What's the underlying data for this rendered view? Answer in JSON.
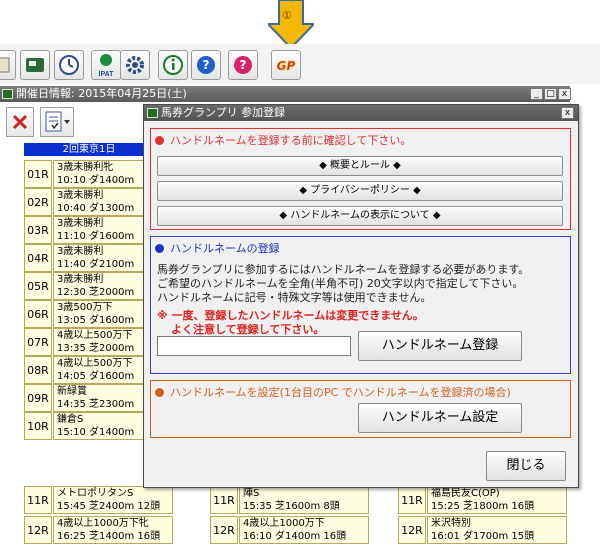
{
  "annotation": {
    "marker": "①",
    "arrow_color": "#f5b800"
  },
  "toolbar": {
    "buttons": [
      {
        "name": "partial-left-icon"
      },
      {
        "name": "card-icon"
      },
      {
        "name": "clock-icon"
      },
      {
        "name": "ipat-icon",
        "label": "IPAT"
      },
      {
        "name": "gear-icon"
      },
      {
        "name": "info-icon"
      },
      {
        "name": "help-icon"
      },
      {
        "name": "question-red-icon"
      },
      {
        "name": "gp-icon",
        "label": "GP"
      }
    ]
  },
  "main_window": {
    "title": "開催日情報: 2015年04月25日(土)",
    "min_label": "_",
    "max_label": "□",
    "close_label": "x"
  },
  "venue_header": "2回東京1日",
  "races_col1": [
    {
      "num": "01R",
      "name": "3歳未勝利牝",
      "info": "10:10 ダ1400m"
    },
    {
      "num": "02R",
      "name": "3歳未勝利",
      "info": "10:40 ダ1300m"
    },
    {
      "num": "03R",
      "name": "3歳未勝利",
      "info": "11:10 ダ1600m"
    },
    {
      "num": "04R",
      "name": "3歳未勝利",
      "info": "11:40 ダ2100m"
    },
    {
      "num": "05R",
      "name": "3歳未勝利",
      "info": "12:30 芝2000m"
    },
    {
      "num": "06R",
      "name": "3歳500万下",
      "info": "13:05 ダ1600m"
    },
    {
      "num": "07R",
      "name": "4歳以上500万下",
      "info": "13:35 芝2000m"
    },
    {
      "num": "08R",
      "name": "4歳以上500万下",
      "info": "14:05 ダ1600m"
    },
    {
      "num": "09R",
      "name": "新緑賞",
      "info": "14:35 芝2300m"
    },
    {
      "num": "10R",
      "name": "鎌倉S",
      "info": "15:10 ダ1400m"
    },
    {
      "num": "11R",
      "name": "メトロポリタンS",
      "info": "15:45 芝2400m 12頭"
    },
    {
      "num": "12R",
      "name": "4歳以上1000万下牝",
      "info": "16:25 芝1400m 16頭"
    }
  ],
  "races_col2": [
    {
      "num": "11R",
      "name": "陣S",
      "info": "15:35 芝1600m 8頭"
    },
    {
      "num": "12R",
      "name": "4歳以上1000万下",
      "info": "16:10 ダ1400m 16頭"
    }
  ],
  "races_col3": [
    {
      "num": "11R",
      "name": "福島民友C(OP)",
      "info": "15:25 芝1800m 16頭"
    },
    {
      "num": "12R",
      "name": "米沢特別",
      "info": "16:01 ダ1700m 15頭"
    }
  ],
  "dialog": {
    "title": "馬券グランプリ 参加登録",
    "close_label": "x",
    "section1": {
      "title": "ハンドルネームを登録する前に確認して下さい。",
      "buttons": [
        "◆ 概要とルール ◆",
        "◆ プライバシーポリシー ◆",
        "◆ ハンドルネームの表示について ◆"
      ]
    },
    "section2": {
      "title": "ハンドルネームの登録",
      "lines": [
        "馬券グランプリに参加するにはハンドルネームを登録する必要があります。",
        "ご希望のハンドルネームを全角(半角不可) 20文字以内で指定して下さい。",
        "ハンドルネームに記号・特殊文字等は使用できません。"
      ],
      "warning1": "※ 一度、登録したハンドルネームは変更できません。",
      "warning2": "よく注意して登録して下さい。",
      "input_value": "",
      "register_button": "ハンドルネーム登録"
    },
    "section3": {
      "title": "ハンドルネームを設定(1台目のPC でハンドルネームを登録済の場合)",
      "set_button": "ハンドルネーム設定"
    },
    "close_button": "閉じる"
  },
  "colors": {
    "section1_border": "#e03030",
    "section2_border": "#3040d0",
    "section3_border": "#d06020",
    "venue_header_bg": "#0c2fd0",
    "card_bg": "#fffde0"
  }
}
